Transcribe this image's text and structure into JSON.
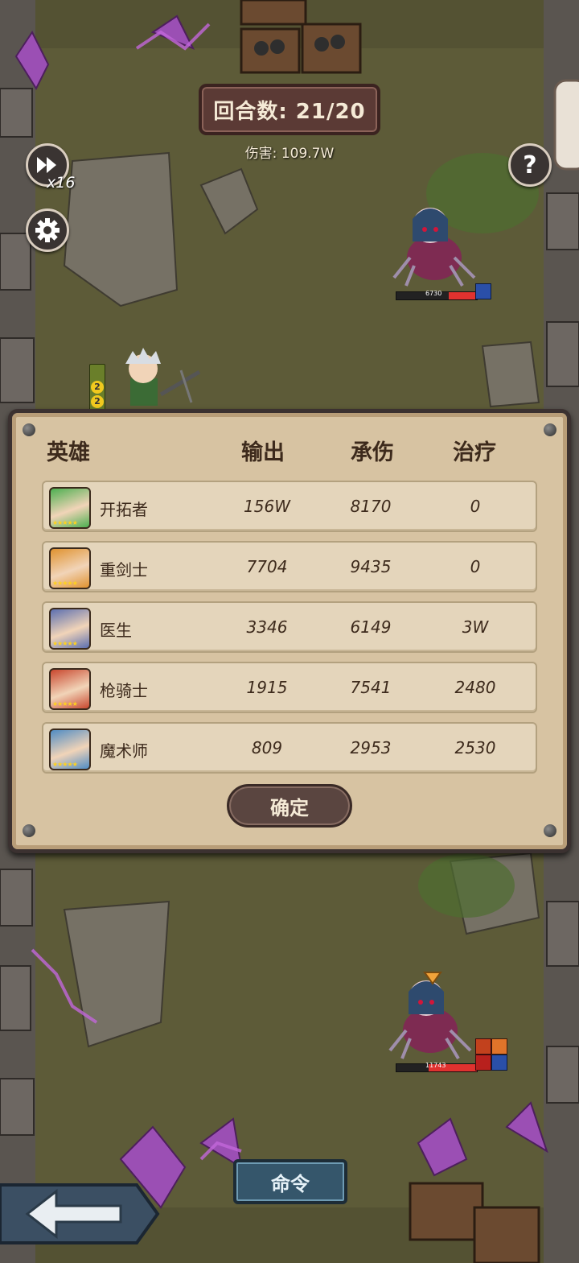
{
  "hud": {
    "round_label": "回合数: 21/20",
    "damage_label": "伤害: 109.7W",
    "speed_label": "x16",
    "speed_icon": "fast-forward-icon",
    "settings_icon": "gear-icon",
    "help_label": "?"
  },
  "enemies": [
    {
      "hp_text": "6730",
      "hp_fraction": 0.35
    },
    {
      "hp_text": "11743",
      "hp_fraction": 0.6
    }
  ],
  "hero_badges": [
    "2",
    "2"
  ],
  "stats": {
    "headers": {
      "hero": "英雄",
      "output": "输出",
      "taken": "承伤",
      "heal": "治疗"
    },
    "rows": [
      {
        "name": "开拓者",
        "output": "156W",
        "taken": "8170",
        "heal": "0",
        "frame_color": "#4caf50"
      },
      {
        "name": "重剑士",
        "output": "7704",
        "taken": "9435",
        "heal": "0",
        "frame_color": "#e0922f"
      },
      {
        "name": "医生",
        "output": "3346",
        "taken": "6149",
        "heal": "3W",
        "frame_color": "#5b6fb0"
      },
      {
        "name": "枪骑士",
        "output": "1915",
        "taken": "7541",
        "heal": "2480",
        "frame_color": "#c9472e"
      },
      {
        "name": "魔术师",
        "output": "809",
        "taken": "2953",
        "heal": "2530",
        "frame_color": "#4f8cc4"
      }
    ],
    "confirm_label": "确定"
  },
  "bottom": {
    "command_label": "命令",
    "back_icon": "back-arrow-icon"
  }
}
